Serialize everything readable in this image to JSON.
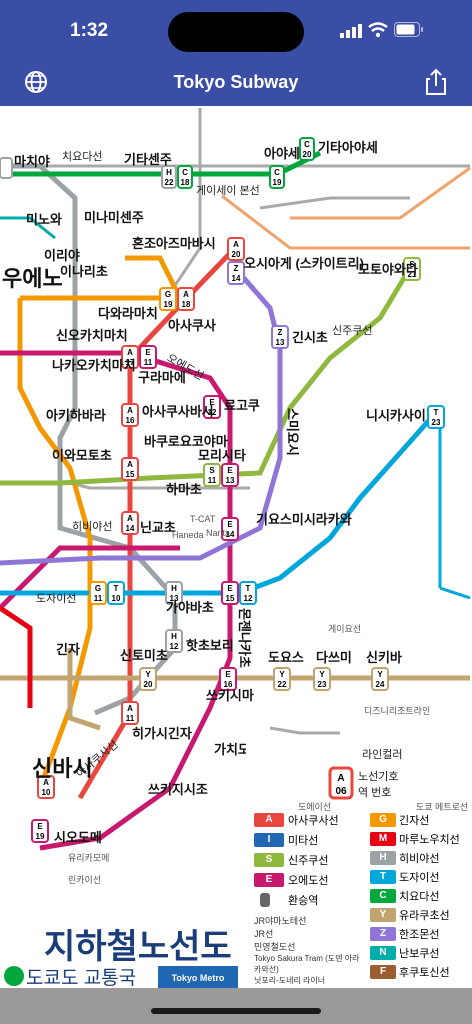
{
  "status_bar": {
    "time": "1:32"
  },
  "nav": {
    "title": "Tokyo Subway",
    "left_icon": "globe-icon",
    "right_icon": "share-icon"
  },
  "colors": {
    "asakusa": "#e8463e",
    "mita": "#1f66b3",
    "shinjuku": "#8fb83f",
    "oedo": "#c8196e",
    "ginza": "#f39800",
    "marunouchi": "#e60012",
    "hibiya": "#9ca3a6",
    "tozai": "#00a7db",
    "chiyoda": "#00a73c",
    "yurakucho": "#c1a470",
    "hanzomon": "#8f76d6",
    "namboku": "#00ada9",
    "fukutoshin": "#9c5e31",
    "jr": "#888888",
    "navbar": "#3a4ea6"
  },
  "stations": [
    {
      "name": "마치야",
      "code": "H17"
    },
    {
      "name": "미노와",
      "code": "H20"
    },
    {
      "name": "미나미센주",
      "code": "H21"
    },
    {
      "name": "기타센주",
      "code": "H22"
    },
    {
      "name": "아야세",
      "code": "C19"
    },
    {
      "name": "기타아야세",
      "code": "C20"
    },
    {
      "name": "이리야",
      "code": "H19"
    },
    {
      "name": "우에노",
      "code": "H18"
    },
    {
      "name": "이나리초",
      "code": "G17"
    },
    {
      "name": "다와라마치",
      "code": "G18"
    },
    {
      "name": "아사쿠사",
      "code": "A18"
    },
    {
      "name": "혼조아즈마바시",
      "code": "A20"
    },
    {
      "name": "오시아게 (스카이트리)",
      "code": "Z14"
    },
    {
      "name": "모토야와타",
      "code": "S21"
    },
    {
      "name": "신오카치마치",
      "code": "E10"
    },
    {
      "name": "나카오카치마치",
      "code": "H17"
    },
    {
      "name": "구라마에",
      "code": "A17"
    },
    {
      "name": "긴시초",
      "code": "Z13"
    },
    {
      "name": "아사쿠사바시",
      "code": "A16"
    },
    {
      "name": "료고쿠",
      "code": "E12"
    },
    {
      "name": "아키하바라",
      "code": "H16"
    },
    {
      "name": "바쿠로요코야마",
      "code": "A15"
    },
    {
      "name": "하마초",
      "code": "S10"
    },
    {
      "name": "모리시타",
      "code": "S11"
    },
    {
      "name": "스미요시",
      "code": "Z12"
    },
    {
      "name": "니시카사이",
      "code": "T17"
    },
    {
      "name": "이와모토초",
      "code": "S08"
    },
    {
      "name": "닌교초",
      "code": "A14"
    },
    {
      "name": "기요스미시라카와",
      "code": "E14"
    },
    {
      "name": "몬젠나카초",
      "code": "T12"
    },
    {
      "name": "가야바초",
      "code": "T11"
    },
    {
      "name": "핫초보리",
      "code": "H12"
    },
    {
      "name": "신토미초",
      "code": "Y20"
    },
    {
      "name": "쓰키시마",
      "code": "E16"
    },
    {
      "name": "도요스",
      "code": "Y22"
    },
    {
      "name": "다쓰미",
      "code": "Y23"
    },
    {
      "name": "신키바",
      "code": "Y24"
    },
    {
      "name": "히가시긴자",
      "code": "A11"
    },
    {
      "name": "긴자",
      "code": "G09"
    },
    {
      "name": "신바시",
      "code": "A10"
    },
    {
      "name": "시오도메",
      "code": "E19"
    },
    {
      "name": "가치도키",
      "code": "E17"
    },
    {
      "name": "쓰키지시조",
      "code": "E18"
    }
  ],
  "map_labels": {
    "chiyoda_line": "치요다선",
    "asakusa_line_label": "아사쿠사선",
    "oedo_line_label": "오에도선",
    "shinjuku_line_label": "신주쿠선",
    "hibiya_line_label": "히비야선",
    "tozai_line_label": "도자이선",
    "keisei_line": "게이세이 본선",
    "jr_keiyo": "게이요선",
    "narita": "Narita",
    "haneda": "Haneda",
    "tcat": "T-CAT",
    "yurikamome": "유리카모메",
    "rinkai": "린카이선",
    "disney": "디즈니리조트라인"
  },
  "legend": {
    "line_color": "라인컬러",
    "line_symbol": "노선기호",
    "station_number": "역 번호",
    "sample_letter": "A",
    "sample_number": "06",
    "toei_header": "도에이선",
    "metro_header": "도쿄 메트로선",
    "toei_lines": [
      {
        "letter": "A",
        "name": "아사쿠사선",
        "color": "#e8463e"
      },
      {
        "letter": "I",
        "name": "미타선",
        "color": "#1f66b3"
      },
      {
        "letter": "S",
        "name": "신주쿠선",
        "color": "#8fb83f"
      },
      {
        "letter": "E",
        "name": "오에도선",
        "color": "#c8196e"
      }
    ],
    "transfer": "환승역",
    "metro_lines": [
      {
        "letter": "G",
        "name": "긴자선",
        "color": "#f39800"
      },
      {
        "letter": "M",
        "name": "마루노우치선",
        "color": "#e60012"
      },
      {
        "letter": "H",
        "name": "히비야선",
        "color": "#9ca3a6"
      },
      {
        "letter": "T",
        "name": "도자이선",
        "color": "#00a7db"
      },
      {
        "letter": "C",
        "name": "치요다선",
        "color": "#00a73c"
      },
      {
        "letter": "Y",
        "name": "유라쿠초선",
        "color": "#c1a470"
      },
      {
        "letter": "Z",
        "name": "한조몬선",
        "color": "#8f76d6"
      },
      {
        "letter": "N",
        "name": "난보쿠선",
        "color": "#00ada9"
      },
      {
        "letter": "F",
        "name": "후쿠토신선",
        "color": "#9c5e31"
      }
    ],
    "other_lines": [
      "JR야마노테선",
      "JR선",
      "민영철도선",
      "Tokyo Sakura Tram (도덴 아라카와선)",
      "닛포리-도네리 라이너"
    ],
    "title": "지하철노선도",
    "toei_brand": "도쿄도 교통국",
    "metro_brand": "Tokyo Metro"
  }
}
